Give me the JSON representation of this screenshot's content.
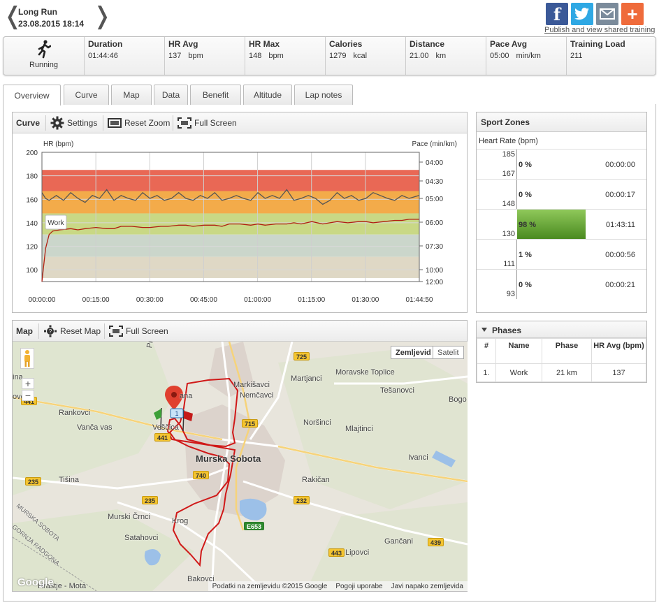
{
  "header": {
    "title": "Long Run",
    "date": "23.08.2015 18:14",
    "publish_link": "Publish and view shared training"
  },
  "social": {
    "facebook": "f",
    "plus": "+"
  },
  "summary": {
    "sport": "Running",
    "stats": [
      {
        "label": "Duration",
        "value": "01:44:46",
        "unit": ""
      },
      {
        "label": "HR Avg",
        "value": "137",
        "unit": "bpm"
      },
      {
        "label": "HR Max",
        "value": "148",
        "unit": "bpm"
      },
      {
        "label": "Calories",
        "value": "1279",
        "unit": "kcal"
      },
      {
        "label": "Distance",
        "value": "21.00",
        "unit": "km"
      },
      {
        "label": "Pace Avg",
        "value": "05:00",
        "unit": "min/km"
      },
      {
        "label": "Training Load",
        "value": "211",
        "unit": ""
      }
    ]
  },
  "tabs": [
    "Overview",
    "Curve",
    "Map",
    "Data",
    "Benefit",
    "Altitude",
    "Lap notes"
  ],
  "active_tab": "Overview",
  "curve_panel": {
    "title": "Curve",
    "settings": "Settings",
    "reset_zoom": "Reset Zoom",
    "full_screen": "Full Screen"
  },
  "chart_data": {
    "type": "line",
    "ylabel_left": "HR (bpm)",
    "ylabel_right": "Pace (min/km)",
    "x_ticks": [
      "00:00:00",
      "00:15:00",
      "00:30:00",
      "00:45:00",
      "01:00:00",
      "01:15:00",
      "01:30:00",
      "01:44:50"
    ],
    "y_left_ticks": [
      "200",
      "180",
      "160",
      "140",
      "120",
      "100"
    ],
    "y_left_range": [
      90,
      200
    ],
    "y_right_ticks": [
      "04:00",
      "04:30",
      "05:00",
      "06:00",
      "07:30",
      "10:00",
      "12:00"
    ],
    "zones": [
      {
        "from": 167,
        "to": 185,
        "color": "#e8604c"
      },
      {
        "from": 148,
        "to": 167,
        "color": "#f2a640"
      },
      {
        "from": 130,
        "to": 148,
        "color": "#c6d67e"
      },
      {
        "from": 111,
        "to": 130,
        "color": "#c8d4c8"
      },
      {
        "from": 93,
        "to": 111,
        "color": "#ddd6c2"
      }
    ],
    "phase_label": "Work",
    "series": [
      {
        "name": "HR",
        "color": "#b01e10",
        "x_minutes": [
          0,
          1,
          2,
          3,
          5,
          8,
          10,
          12,
          15,
          18,
          20,
          22,
          25,
          28,
          30,
          33,
          35,
          38,
          40,
          42,
          45,
          48,
          50,
          52,
          55,
          58,
          60,
          62,
          65,
          68,
          70,
          72,
          75,
          78,
          80,
          82,
          85,
          88,
          90,
          92,
          95,
          98,
          100,
          102,
          104.8
        ],
        "values": [
          90,
          118,
          130,
          133,
          134,
          135,
          134,
          135,
          136,
          135,
          135,
          137,
          137,
          136,
          136,
          137,
          137,
          138,
          138,
          137,
          138,
          138,
          137,
          139,
          139,
          138,
          139,
          138,
          139,
          139,
          140,
          139,
          141,
          139,
          140,
          141,
          140,
          141,
          141,
          140,
          141,
          142,
          142,
          143,
          143
        ]
      },
      {
        "name": "Pace",
        "color": "#555555",
        "x_minutes": [
          0,
          1,
          2,
          4,
          6,
          8,
          10,
          12,
          14,
          16,
          18,
          20,
          22,
          24,
          26,
          28,
          30,
          32,
          34,
          36,
          38,
          40,
          42,
          44,
          46,
          48,
          50,
          52,
          54,
          56,
          58,
          60,
          62,
          64,
          66,
          68,
          70,
          72,
          74,
          76,
          78,
          80,
          82,
          84,
          86,
          88,
          90,
          92,
          94,
          96,
          98,
          100,
          102,
          104.8
        ],
        "values": [
          "04:50",
          "05:00",
          "05:05",
          "04:55",
          "05:05",
          "04:50",
          "05:00",
          "05:10",
          "04:55",
          "05:00",
          "04:45",
          "05:05",
          "04:55",
          "05:00",
          "05:05",
          "04:50",
          "05:00",
          "04:55",
          "05:05",
          "05:00",
          "04:50",
          "05:00",
          "05:05",
          "04:55",
          "05:00",
          "04:50",
          "05:05",
          "05:00",
          "04:55",
          "05:00",
          "05:05",
          "04:50",
          "05:00",
          "04:55",
          "05:00",
          "04:45",
          "05:05",
          "05:00",
          "04:55",
          "05:00",
          "05:15",
          "05:05",
          "04:50",
          "05:00",
          "04:55",
          "05:05",
          "05:00",
          "04:50",
          "04:55",
          "05:00",
          "05:05",
          "04:55",
          "05:00",
          "04:55"
        ]
      }
    ]
  },
  "sport_zones": {
    "title": "Sport Zones",
    "subtitle": "Heart Rate (bpm)",
    "zones": [
      {
        "max": "185",
        "min": "167",
        "percent": "0 %",
        "fraction": 0.0,
        "time": "00:00:00"
      },
      {
        "max": "",
        "min": "148",
        "percent": "0 %",
        "fraction": 0.0,
        "time": "00:00:17"
      },
      {
        "max": "",
        "min": "130",
        "percent": "98 %",
        "fraction": 0.98,
        "time": "01:43:11"
      },
      {
        "max": "",
        "min": "111",
        "percent": "1 %",
        "fraction": 0.01,
        "time": "00:00:56"
      },
      {
        "max": "",
        "min": "93",
        "percent": "0 %",
        "fraction": 0.0,
        "time": "00:00:21"
      }
    ]
  },
  "phases": {
    "title": "Phases",
    "headers": [
      "#",
      "Name",
      "Phase",
      "HR Avg (bpm)"
    ],
    "rows": [
      {
        "num": "1.",
        "name": "Work",
        "phase": "21 km",
        "hr": "137"
      }
    ]
  },
  "map_panel": {
    "title": "Map",
    "reset_map": "Reset Map",
    "full_screen": "Full Screen",
    "map_type_selected": "Zemljevid",
    "map_type_other": "Satelit",
    "zoom_in": "+",
    "zoom_out": "−",
    "places": [
      "Predanovci",
      "Markišavci",
      "Martjanci",
      "Moravske Toplice",
      "Nemčavci",
      "Tešanovci",
      "Bogo",
      "Rankovci",
      "Vanča vas",
      "Veščica",
      "Noršinci",
      "Mlajtinci",
      "Murska Sobota",
      "Ivanci",
      "Tišina",
      "Rakičan",
      "Murski Črnci",
      "Krog",
      "Satahovci",
      "Gančani",
      "Lipovci",
      "Bakovci",
      "Hrastje - Mota",
      "MURSKA SOBOTA",
      "GORNJA RADGONA",
      "ina",
      "ovci",
      "ana"
    ],
    "roads": [
      "725",
      "441",
      "715",
      "441",
      "740",
      "235",
      "232",
      "235",
      "E653",
      "443",
      "439"
    ],
    "start_marker": "1",
    "footer": [
      "Podatki na zemljevidu ©2015 Google",
      "Pogoji uporabe",
      "Javi napako zemljevida"
    ],
    "google_logo": "Google"
  }
}
